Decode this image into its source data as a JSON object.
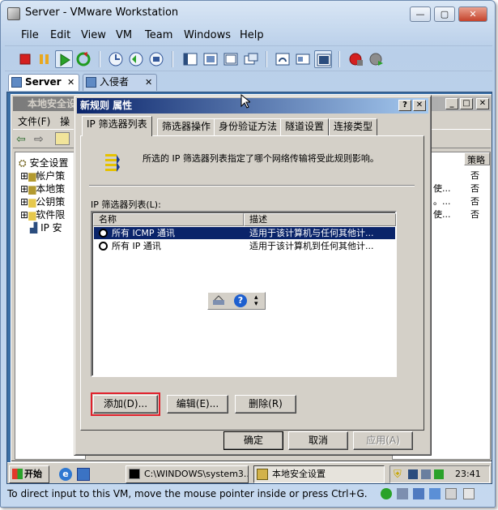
{
  "vm_window": {
    "title": "Server - VMware Workstation",
    "menu": [
      "File",
      "Edit",
      "View",
      "VM",
      "Team",
      "Windows",
      "Help"
    ],
    "tabs": [
      {
        "label": "Server",
        "close": "✕"
      },
      {
        "label": "入侵者",
        "close": "✕"
      }
    ],
    "status_message": "To direct input to this VM, move the mouse pointer inside or press Ctrl+G."
  },
  "background_window": {
    "title": "本地安全设",
    "menu": [
      "文件(F)",
      "操"
    ],
    "tree": [
      {
        "label": "安全设置"
      },
      {
        "label": "帐户策"
      },
      {
        "label": "本地策"
      },
      {
        "label": "公钥策"
      },
      {
        "label": "软件限"
      },
      {
        "label": "IP 安"
      }
    ],
    "right_header": "策略",
    "right_rows": [
      {
        "desc": "",
        "value": "否"
      },
      {
        "desc": "使...",
        "value": "否"
      },
      {
        "desc": "。...",
        "value": "否"
      },
      {
        "desc": "使...",
        "value": "否"
      }
    ]
  },
  "dialog": {
    "title": "新规则 属性",
    "help_btn": "?",
    "close_btn": "✕",
    "tabs": [
      "IP 筛选器列表",
      "筛选器操作",
      "身份验证方法",
      "隧道设置",
      "连接类型"
    ],
    "description": "所选的 IP 筛选器列表指定了哪个网络传输将受此规则影响。",
    "list_label": "IP 筛选器列表(L):",
    "columns": [
      "名称",
      "描述"
    ],
    "rows": [
      {
        "name": "所有 ICMP 通讯",
        "desc": "适用于该计算机与任何其他计...",
        "selected": true
      },
      {
        "name": "所有 IP 通讯",
        "desc": "适用于该计算机到任何其他计...",
        "selected": false
      }
    ],
    "buttons": {
      "add": "添加(D)...",
      "edit": "编辑(E)...",
      "remove": "删除(R)",
      "ok": "确定",
      "cancel": "取消",
      "apply": "应用(A)"
    }
  },
  "guest_taskbar": {
    "start": "开始",
    "tasks": [
      "C:\\WINDOWS\\system3...",
      "本地安全设置"
    ],
    "clock": "23:41"
  },
  "colors": {
    "selection": "#0a246a",
    "highlight_box": "#e0202c",
    "dialog_face": "#d4d0c8"
  }
}
